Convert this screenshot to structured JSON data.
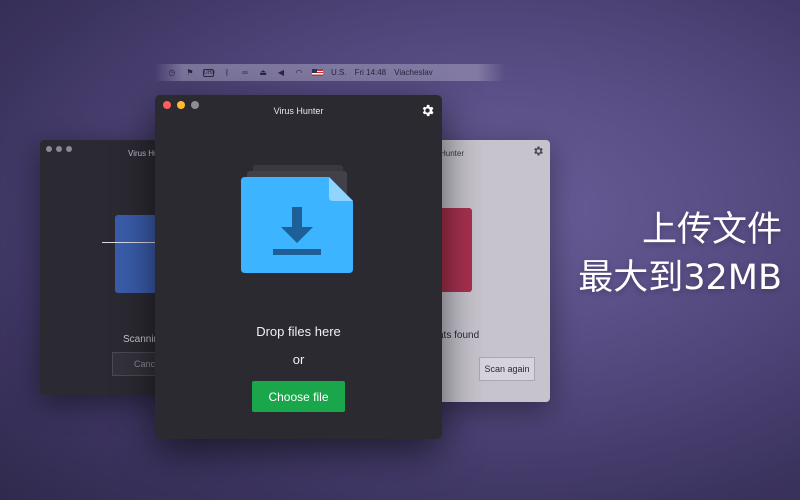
{
  "menubar": {
    "icons": [
      "time-machine-icon",
      "flag-icon",
      "display-icon",
      "bluetooth-icon",
      "binoculars-icon",
      "eject-icon",
      "volume-icon",
      "wifi-icon"
    ],
    "display_box": "UHD",
    "input_source": "U.S.",
    "clock": "Fri 14:48",
    "user": "Viacheslav"
  },
  "left_window": {
    "title": "Virus Hun",
    "status": "Scannin",
    "cancel_label": "Cance",
    "doc_color": "#3c62b8"
  },
  "right_window": {
    "title": "Hunter",
    "status": "ats found",
    "scan_again_label": "Scan again",
    "doc_color": "#a8304e"
  },
  "main_window": {
    "title": "Virus Hunter",
    "drop_text": "Drop files here",
    "or_text": "or",
    "choose_label": "Choose file",
    "accent_color": "#1aa64a",
    "file_icon_color": "#3cb4ff"
  },
  "caption": {
    "line1": "上传文件",
    "line2": "最大到32MB"
  }
}
